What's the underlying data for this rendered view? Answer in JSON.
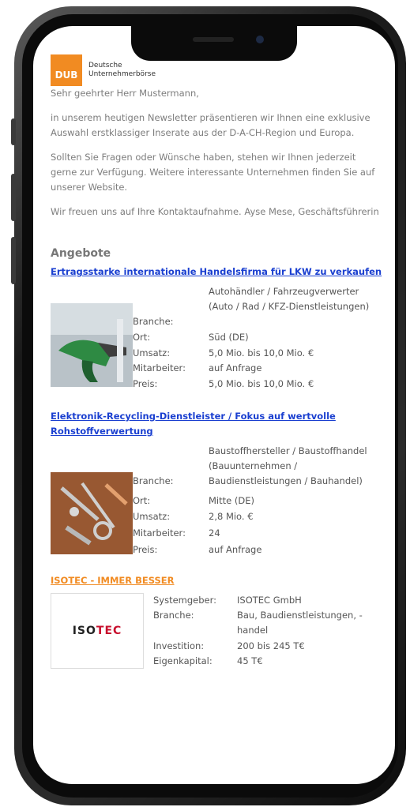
{
  "logo": {
    "short": "DUB",
    "name_line1": "Deutsche",
    "name_line2": "Unternehmerbörse"
  },
  "email": {
    "greeting": "Sehr geehrter Herr Mustermann,",
    "para1": "in unserem heutigen Newsletter präsentieren wir Ihnen eine exklusive Auswahl erstklassiger Inserate aus der D-A-CH-Region und Europa.",
    "para2": "Sollten Sie Fragen oder Wünsche haben, stehen wir Ihnen jederzeit gerne zur Verfügung. Weitere interessante Unternehmen finden Sie auf unserer Website.",
    "para3": "Wir freuen uns auf Ihre Kontaktaufnahme. Ayse Mese, Geschäftsführerin"
  },
  "offers_heading": "Angebote",
  "offers": [
    {
      "title": "Ertragsstarke internationale Handelsfirma für LKW zu verkaufen",
      "rows": [
        {
          "label": "Branche:",
          "value": "Autohändler / Fahrzeugverwerter (Auto / Rad / KFZ-Dienstleistungen)"
        },
        {
          "label": "Ort:",
          "value": "Süd (DE)"
        },
        {
          "label": "Umsatz:",
          "value": "5,0 Mio. bis 10,0 Mio. €"
        },
        {
          "label": "Mitarbeiter:",
          "value": "auf Anfrage"
        },
        {
          "label": "Preis:",
          "value": "5,0 Mio. bis 10,0 Mio. €"
        }
      ]
    },
    {
      "title": "Elektronik-Recycling-Dienstleister / Fokus auf wertvolle Rohstoffverwertung",
      "rows": [
        {
          "label": "Branche:",
          "value": "Baustoffhersteller / Baustoffhandel (Bauunternehmen / Baudienstleistungen / Bauhandel)"
        },
        {
          "label": "Ort:",
          "value": "Mitte (DE)"
        },
        {
          "label": "Umsatz:",
          "value": "2,8 Mio. €"
        },
        {
          "label": "Mitarbeiter:",
          "value": "24"
        },
        {
          "label": "Preis:",
          "value": "auf Anfrage"
        }
      ]
    }
  ],
  "franchise": {
    "title": "ISOTEC - IMMER BESSER",
    "logo_a": "ISO",
    "logo_b": "TEC",
    "rows": [
      {
        "label": "Systemgeber:",
        "value": "ISOTEC GmbH"
      },
      {
        "label": "Branche:",
        "value": "Bau, Baudienstleistungen, -handel"
      },
      {
        "label": "Investition:",
        "value": "200 bis 245 T€"
      },
      {
        "label": "Eigenkapital:",
        "value": "45 T€"
      }
    ]
  },
  "colors": {
    "accent": "#f18b22",
    "link": "#1a3fd0",
    "text": "#7d7d7d"
  }
}
